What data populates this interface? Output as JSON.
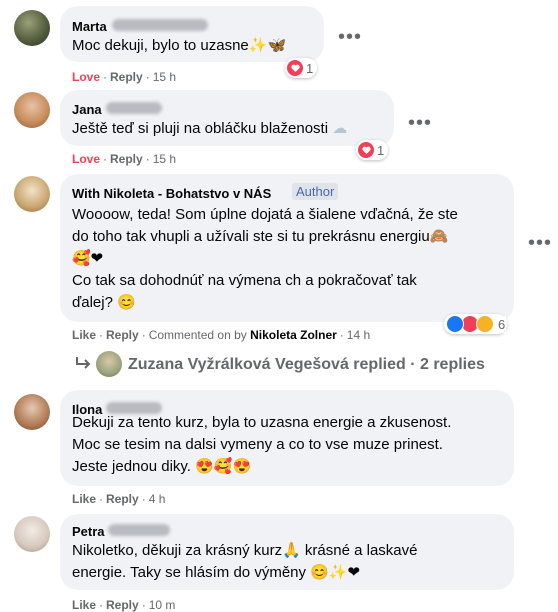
{
  "colors": {
    "bubble": "#f0f2f5",
    "meta": "#65676b",
    "love": "#f33e58",
    "author_badge_bg": "#dfe3ea",
    "author_badge_fg": "#4b6aa8"
  },
  "comments": [
    {
      "name": "Marta",
      "text": [
        "Moc dekuji, bylo to uzasne"
      ],
      "emoji_suffix": "✨🦋",
      "actions": {
        "reaction": "Love",
        "reply": "Reply",
        "time": "15 h"
      },
      "reaction_count": "1",
      "reaction_icons": [
        "heart-icon"
      ]
    },
    {
      "name": "Jana",
      "text": [
        "Ještě teď si pluji na obláčku blaženosti"
      ],
      "emoji_suffix": "☁",
      "actions": {
        "reaction": "Love",
        "reply": "Reply",
        "time": "15 h"
      },
      "reaction_count": "1",
      "reaction_icons": [
        "heart-icon"
      ]
    },
    {
      "name": "With Nikoleta - Bohatstvo v NÁS",
      "badge": "Author",
      "text": [
        "Woooow, teda! Som úplne dojatá a šialene vďačná, že ste",
        "do toho tak vhupli a užívali ste si tu prekrásnu energiu🙈",
        "🥰❤",
        "Co tak sa dohodnúť na výmena ch a pokračovať tak",
        "ďalej? 😊"
      ],
      "actions": {
        "reaction": "Like",
        "reply": "Reply",
        "commented_on_by": "Commented on by",
        "commenter": "Nikoleta Zolner",
        "time": "14 h"
      },
      "reaction_count": "6",
      "reaction_icons": [
        "like-icon",
        "heart-icon",
        "haha-icon"
      ]
    },
    {
      "name": "Ilona",
      "text": [
        "Dekuji za tento kurz, byla to uzasna energie a zkusenost.",
        "Moc se tesim na dalsi vymeny a co to vse muze prinest.",
        "Jeste jednou diky. 😍🥰😍"
      ],
      "actions": {
        "reaction": "Like",
        "reply": "Reply",
        "time": "4 h"
      }
    },
    {
      "name": "Petra",
      "text": [
        "Nikoletko, děkuji za krásný kurz🙏 krásné a laskavé",
        "energie. Taky se hlásím do výměny 😊✨❤"
      ],
      "actions": {
        "reaction": "Like",
        "reply": "Reply",
        "time": "10 m"
      }
    }
  ],
  "replies_row": {
    "text": "Zuzana Vyžrálková Vegešová replied · 2 replies"
  },
  "icons": {
    "more": "more-options-icon",
    "reply_arrow": "reply-arrow-icon"
  }
}
